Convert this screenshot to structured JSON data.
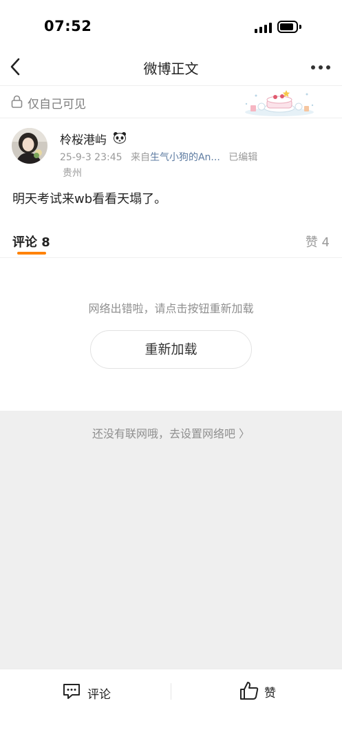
{
  "status_bar": {
    "time": "07:52"
  },
  "nav": {
    "title": "微博正文"
  },
  "visibility": {
    "label": "仅自己可见"
  },
  "post": {
    "username": "柃桜港屿",
    "timestamp": "25-9-3 23:45",
    "source_prefix": "来自",
    "source_name": "生气小狗的An...",
    "edited": "已编辑",
    "location": "贵州",
    "text": "明天考试来wb看看天塌了。"
  },
  "tabs": {
    "comments_label": "评论 8",
    "likes_label": "赞 4"
  },
  "error": {
    "message": "网络出错啦，请点击按钮重新加载",
    "reload_label": "重新加载"
  },
  "network": {
    "message": "还没有联网哦，去设置网络吧 〉"
  },
  "bottom_bar": {
    "comment_label": "评论",
    "like_label": "赞"
  },
  "colors": {
    "accent": "#ff8200",
    "link": "#5d7ba1",
    "muted_text": "#8f8f8f",
    "grey_background": "#efefef"
  },
  "icons": [
    "back-arrow-icon",
    "more-dots-icon",
    "lock-icon",
    "panda-icon",
    "comment-icon",
    "thumbs-up-icon"
  ]
}
